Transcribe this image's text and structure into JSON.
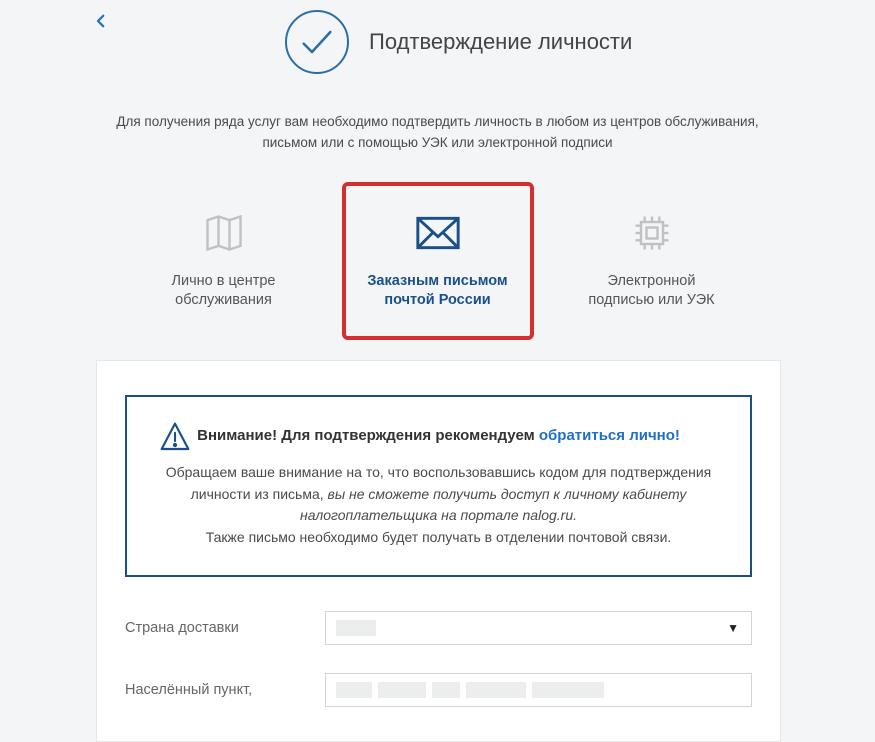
{
  "header": {
    "title": "Подтверждение личности",
    "intro": "Для получения ряда услуг вам необходимо подтвердить личность в любом из центров обслуживания, письмом или с помощью УЭК или электронной подписи"
  },
  "options": {
    "in_person": "Лично в центре обслуживания",
    "by_mail_line1": "Заказным письмом",
    "by_mail_line2": "почтой России",
    "digital_line1": "Электронной",
    "digital_line2": "подписью или УЭК"
  },
  "notice": {
    "title_prefix": "Внимание! Для подтверждения рекомендуем ",
    "title_link": "обратиться лично!",
    "body_line1": "Обращаем ваше внимание на то, что воспользовавшись кодом для подтверждения личности из письма, ",
    "body_italic": "вы не сможете получить доступ к личному кабинету налогоплательщика на портале nalog.ru.",
    "body_line2": "Также письмо необходимо будет получать в отделении почтовой связи."
  },
  "form": {
    "country_label": "Страна доставки",
    "city_label": "Населённый пункт,"
  }
}
